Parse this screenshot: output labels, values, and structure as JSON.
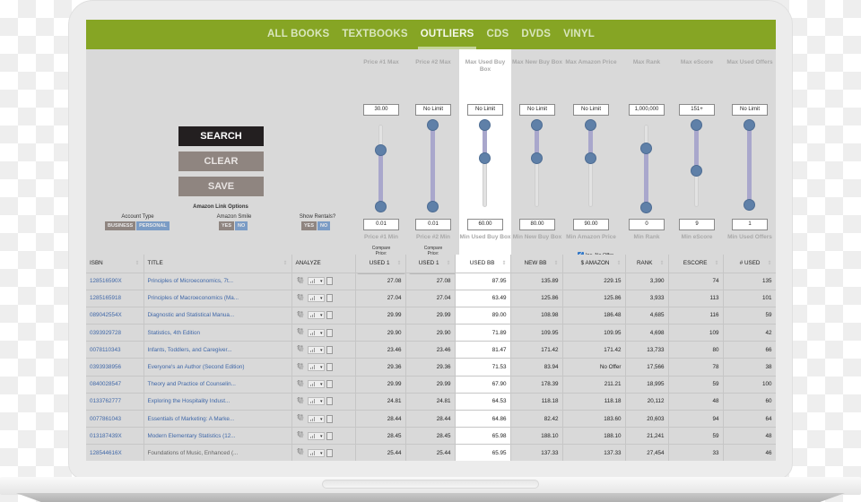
{
  "nav": {
    "tabs": [
      {
        "label": "ALL BOOKS",
        "active": false
      },
      {
        "label": "TEXTBOOKS",
        "active": false
      },
      {
        "label": "OUTLIERS",
        "active": true
      },
      {
        "label": "CDS",
        "active": false
      },
      {
        "label": "DVDS",
        "active": false
      },
      {
        "label": "VINYL",
        "active": false
      }
    ]
  },
  "actions": {
    "search": "SEARCH",
    "clear": "CLEAR",
    "save": "SAVE"
  },
  "link_options": {
    "title": "Amazon Link Options",
    "account_type": {
      "label": "Account Type",
      "options": [
        "BUSINESS",
        "PERSONAL"
      ],
      "selected": "PERSONAL"
    },
    "amazon_smile": {
      "label": "Amazon Smile",
      "options": [
        "YES",
        "NO"
      ],
      "selected": "NO"
    },
    "show_rentals": {
      "label": "Show Rentals?",
      "options": [
        "YES",
        "NO"
      ],
      "selected": "NO"
    }
  },
  "filters": [
    {
      "max_label": "Price #1 Max",
      "max_value": "30.00",
      "min_label": "Price #1 Min",
      "min_value": "0.01",
      "range": [
        0.01,
        0.7
      ],
      "compare_label": "Compare Price:",
      "compare_value": "Used 1"
    },
    {
      "max_label": "Price #2 Max",
      "max_value": "No Limit",
      "min_label": "Price #2 Min",
      "min_value": "0.01",
      "range": [
        0.01,
        1.0
      ],
      "compare_label": "Compare Price:",
      "compare_value": "Used 1"
    },
    {
      "max_label": "Max Used Buy Box",
      "max_value": "No Limit",
      "min_label": "Min Used Buy Box",
      "min_value": "60.00",
      "range": [
        0.6,
        1.0
      ]
    },
    {
      "max_label": "Max New Buy Box",
      "max_value": "No Limit",
      "min_label": "Min New Buy Box",
      "min_value": "80.00",
      "range": [
        0.6,
        1.0
      ]
    },
    {
      "max_label": "Max Amazon Price",
      "max_value": "No Limit",
      "min_label": "Min Amazon Price",
      "min_value": "90.00",
      "range": [
        0.6,
        1.0
      ],
      "checkbox_label": "Inc. No Offer",
      "checkbox_checked": true
    },
    {
      "max_label": "Max Rank",
      "max_value": "1,000,000",
      "min_label": "Min Rank",
      "min_value": "0",
      "range": [
        0.0,
        0.72
      ]
    },
    {
      "max_label": "Max eScore",
      "max_value": "151+",
      "min_label": "Min eScore",
      "min_value": "9",
      "range": [
        0.45,
        1.0
      ]
    },
    {
      "max_label": "Max Used Offers",
      "max_value": "No Limit",
      "min_label": "Min Used Offers",
      "min_value": "1",
      "range": [
        0.03,
        1.0
      ]
    }
  ],
  "table": {
    "columns": [
      "ISBN",
      "TITLE",
      "ANALYZE",
      "USED 1",
      "USED 1",
      "USED BB",
      "NEW BB",
      "$ AMAZON",
      "RANK",
      "ESCORE",
      "# USED"
    ],
    "rows": [
      [
        "128516590X",
        "Principles of Microeconomics, 7t...",
        "27.08",
        "27.08",
        "87.95",
        "135.89",
        "229.15",
        "3,390",
        "74",
        "135"
      ],
      [
        "1285165918",
        "Principles of Macroeconomics (Ma...",
        "27.04",
        "27.04",
        "63.49",
        "125.86",
        "125.86",
        "3,933",
        "113",
        "101"
      ],
      [
        "089042554X",
        "Diagnostic and Statistical Manua...",
        "29.99",
        "29.99",
        "89.00",
        "108.98",
        "186.48",
        "4,685",
        "116",
        "59"
      ],
      [
        "0393929728",
        "Statistics, 4th Edition",
        "29.90",
        "29.90",
        "71.89",
        "109.95",
        "109.95",
        "4,698",
        "109",
        "42"
      ],
      [
        "0078110343",
        "Infants, Toddlers, and Caregiver...",
        "23.46",
        "23.46",
        "81.47",
        "171.42",
        "171.42",
        "13,733",
        "80",
        "66"
      ],
      [
        "0393938956",
        "Everyone's an Author (Second Edition)",
        "29.36",
        "29.36",
        "71.53",
        "83.94",
        "No Offer",
        "17,566",
        "78",
        "38"
      ],
      [
        "0840028547",
        "Theory and Practice of Counselin...",
        "29.99",
        "29.99",
        "67.90",
        "178.39",
        "211.21",
        "18,995",
        "59",
        "100"
      ],
      [
        "0133762777",
        "Exploring the Hospitality Indust...",
        "24.81",
        "24.81",
        "64.53",
        "118.18",
        "118.18",
        "20,112",
        "48",
        "60"
      ],
      [
        "0077861043",
        "Essentials of Marketing: A Marke...",
        "28.44",
        "28.44",
        "64.86",
        "82.42",
        "183.60",
        "20,603",
        "94",
        "64"
      ],
      [
        "013187439X",
        "Modern Elementary Statistics (12...",
        "28.45",
        "28.45",
        "65.98",
        "188.10",
        "188.10",
        "21,241",
        "59",
        "48"
      ],
      [
        "128544616X",
        "Foundations of Music, Enhanced (...",
        "25.44",
        "25.44",
        "65.95",
        "137.33",
        "137.33",
        "27,454",
        "33",
        "46"
      ]
    ],
    "analyze_icons": [
      "camel-icon",
      "chart-dropdown-icon",
      "calculator-icon"
    ]
  },
  "colors": {
    "brand_green": "#86a524",
    "link_blue": "#3f67a8",
    "toggle_active": "#7b9cc5",
    "toggle_inactive": "#8f8580",
    "slider_knob": "#5f80a8"
  }
}
